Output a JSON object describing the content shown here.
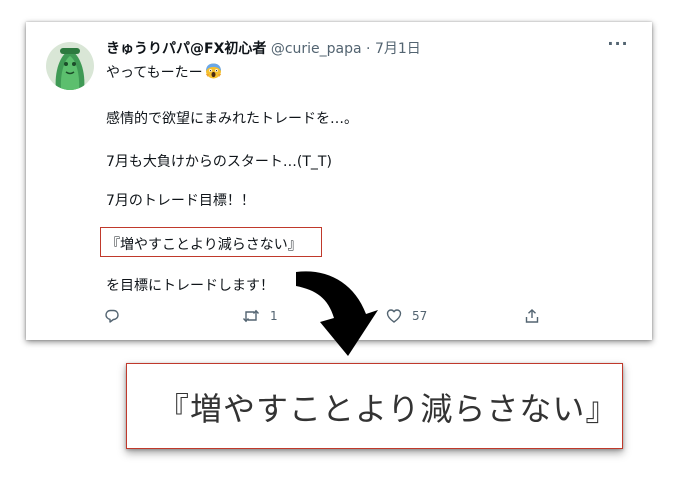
{
  "tweet": {
    "display_name": "きゅうりパパ@FX初心者",
    "handle": "@curie_papa",
    "separator": "·",
    "date": "7月1日",
    "more_label": "···",
    "line1": "やってもーたー",
    "line1_emoji": "face-screaming-in-fear-icon",
    "line2": "感情的で欲望にまみれたトレードを…。",
    "line3": "7月も大負けからのスタート…(T_T)",
    "line4": "7月のトレード目標！！",
    "line5": "『増やすことより減らさない』",
    "line6": "を目標にトレードします！",
    "actions": {
      "reply_icon": "reply-icon",
      "retweet_icon": "retweet-icon",
      "retweet_count": "1",
      "like_icon": "heart-icon",
      "like_count": "57",
      "share_icon": "share-icon"
    }
  },
  "callout": {
    "text": "『増やすことより減らさない』",
    "arrow_icon": "curved-arrow-down-icon",
    "accent_color": "#c0392b"
  }
}
